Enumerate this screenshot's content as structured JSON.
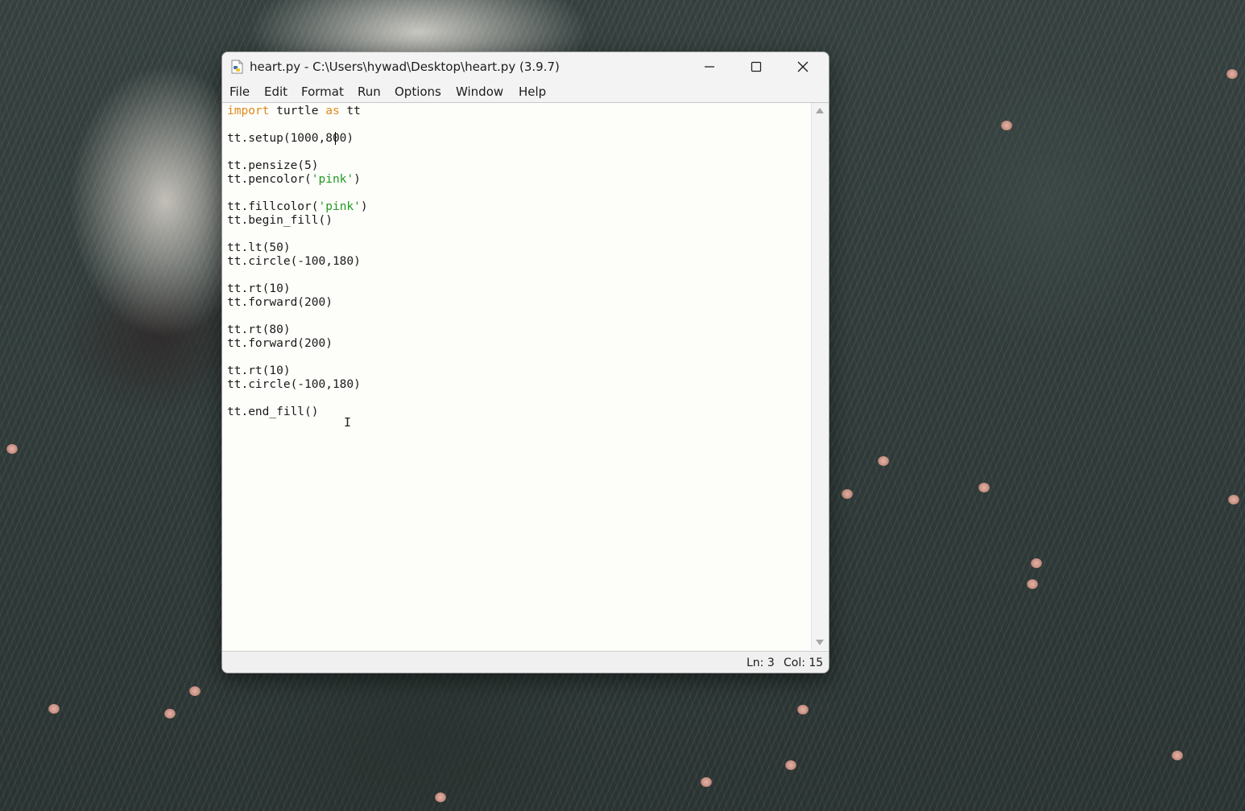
{
  "window": {
    "title": "heart.py - C:\\Users\\hywad\\Desktop\\heart.py (3.9.7)",
    "icon": "python-file-icon"
  },
  "menu": [
    "File",
    "Edit",
    "Format",
    "Run",
    "Options",
    "Window",
    "Help"
  ],
  "code_lines": [
    [
      {
        "t": "import",
        "c": "kw"
      },
      {
        "t": " turtle "
      },
      {
        "t": "as",
        "c": "kw"
      },
      {
        "t": " tt"
      }
    ],
    [],
    [
      {
        "t": "tt.setup(1000,800)"
      }
    ],
    [],
    [
      {
        "t": "tt.pensize(5)"
      }
    ],
    [
      {
        "t": "tt.pencolor("
      },
      {
        "t": "'pink'",
        "c": "str"
      },
      {
        "t": ")"
      }
    ],
    [],
    [
      {
        "t": "tt.fillcolor("
      },
      {
        "t": "'pink'",
        "c": "str"
      },
      {
        "t": ")"
      }
    ],
    [
      {
        "t": "tt.begin_fill()"
      }
    ],
    [],
    [
      {
        "t": "tt.lt(50)"
      }
    ],
    [
      {
        "t": "tt.circle(-100,180)"
      }
    ],
    [],
    [
      {
        "t": "tt.rt(10)"
      }
    ],
    [
      {
        "t": "tt.forward(200)"
      }
    ],
    [],
    [
      {
        "t": "tt.rt(80)"
      }
    ],
    [
      {
        "t": "tt.forward(200)"
      }
    ],
    [],
    [
      {
        "t": "tt.rt(10)"
      }
    ],
    [
      {
        "t": "tt.circle(-100,180)"
      }
    ],
    [],
    [
      {
        "t": "tt.end_fill()"
      }
    ]
  ],
  "status": {
    "line": "Ln: 3",
    "col": "Col: 15"
  },
  "colors": {
    "keyword": "#e0891a",
    "string": "#1f9a1f",
    "text": "#1a1a1a"
  }
}
